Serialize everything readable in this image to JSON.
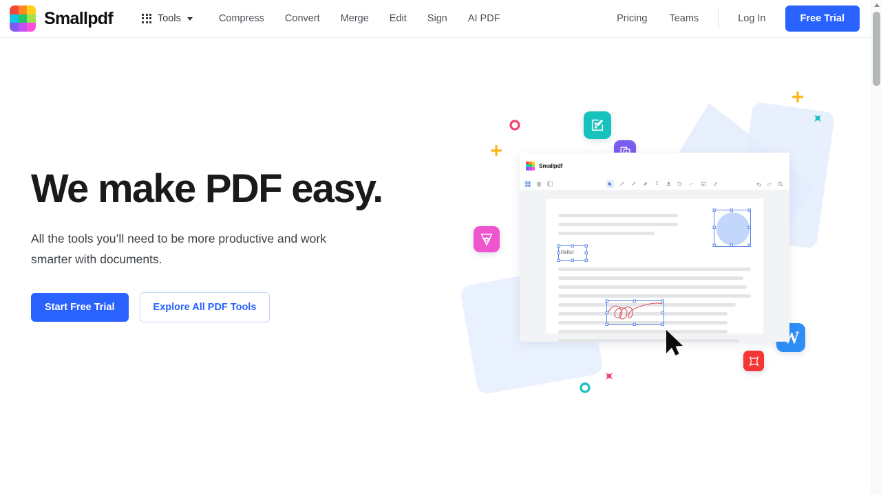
{
  "navbar": {
    "brand_name": "Smallpdf",
    "logo_icon": "smallpdf-logo-grid",
    "logo_colors": [
      "#f5463b",
      "#ff8a1e",
      "#ffd11a",
      "#17c2e8",
      "#21c768",
      "#a0e24b",
      "#7b5cf0",
      "#c550f5",
      "#ff4fd8"
    ],
    "tools_label": "Tools",
    "tools_icon": "grid-dots-icon",
    "caret_icon": "chevron-down-icon",
    "links": [
      {
        "label": "Compress"
      },
      {
        "label": "Convert"
      },
      {
        "label": "Merge"
      },
      {
        "label": "Edit"
      },
      {
        "label": "Sign"
      },
      {
        "label": "AI PDF"
      }
    ],
    "right_links": [
      {
        "label": "Pricing"
      },
      {
        "label": "Teams"
      }
    ],
    "login_label": "Log In",
    "free_trial_label": "Free Trial",
    "accent_color": "#2962ff"
  },
  "hero": {
    "title": "We make PDF easy.",
    "subtitle": "All the tools you’ll need to be more productive and work smarter with documents.",
    "primary_cta": "Start Free Trial",
    "secondary_cta": "Explore All PDF Tools",
    "primary_color": "#2962ff",
    "secondary_color": "#2962ff"
  },
  "illustration": {
    "mockup": {
      "brand_name": "Smallpdf",
      "logo_icon": "smallpdf-logo-grid",
      "left_tools": [
        "grid-view-icon",
        "single-page-icon",
        "sidebar-panel-icon"
      ],
      "center_tools": [
        "cursor-select-icon",
        "pencil-icon",
        "highlighter-icon",
        "eraser-icon",
        "text-tool-icon",
        "stamp-icon",
        "shape-rectangle-icon",
        "line-tool-icon",
        "image-tool-icon",
        "signature-icon"
      ],
      "right_tools": [
        "undo-icon",
        "redo-icon",
        "zoom-icon"
      ],
      "document": {
        "text_annotation": "Hello!",
        "shapes": [
          "circle-object",
          "freehand-scribble"
        ],
        "cursor_icon": "mouse-pointer-icon"
      }
    },
    "floating_tools": [
      {
        "name": "edit-document-icon",
        "color": "#17c2bd"
      },
      {
        "name": "duplicate-pages-icon",
        "color": "#7b5cf0"
      },
      {
        "name": "sign-pen-nib-icon",
        "color": "#ef55cf"
      },
      {
        "name": "image-photo-icon",
        "color": "#fcb415"
      },
      {
        "name": "word-convert-icon",
        "color": "#2e8ef7",
        "label": "W"
      },
      {
        "name": "compress-icon",
        "color": "#f43636"
      }
    ],
    "decorations": [
      {
        "name": "circle-outline-pink",
        "color": "#f4436e"
      },
      {
        "name": "plus-orange",
        "color": "#fcb415"
      },
      {
        "name": "plus-orange-2",
        "color": "#fcb415"
      },
      {
        "name": "x-mark-teal",
        "color": "#17c2bd"
      },
      {
        "name": "x-mark-red",
        "color": "#f4436e"
      },
      {
        "name": "circle-outline-teal",
        "color": "#17c2bd"
      }
    ],
    "background_color": "#e3ecfd"
  },
  "scrollbar": {
    "arrow_icon": "scroll-up-arrow-icon"
  }
}
